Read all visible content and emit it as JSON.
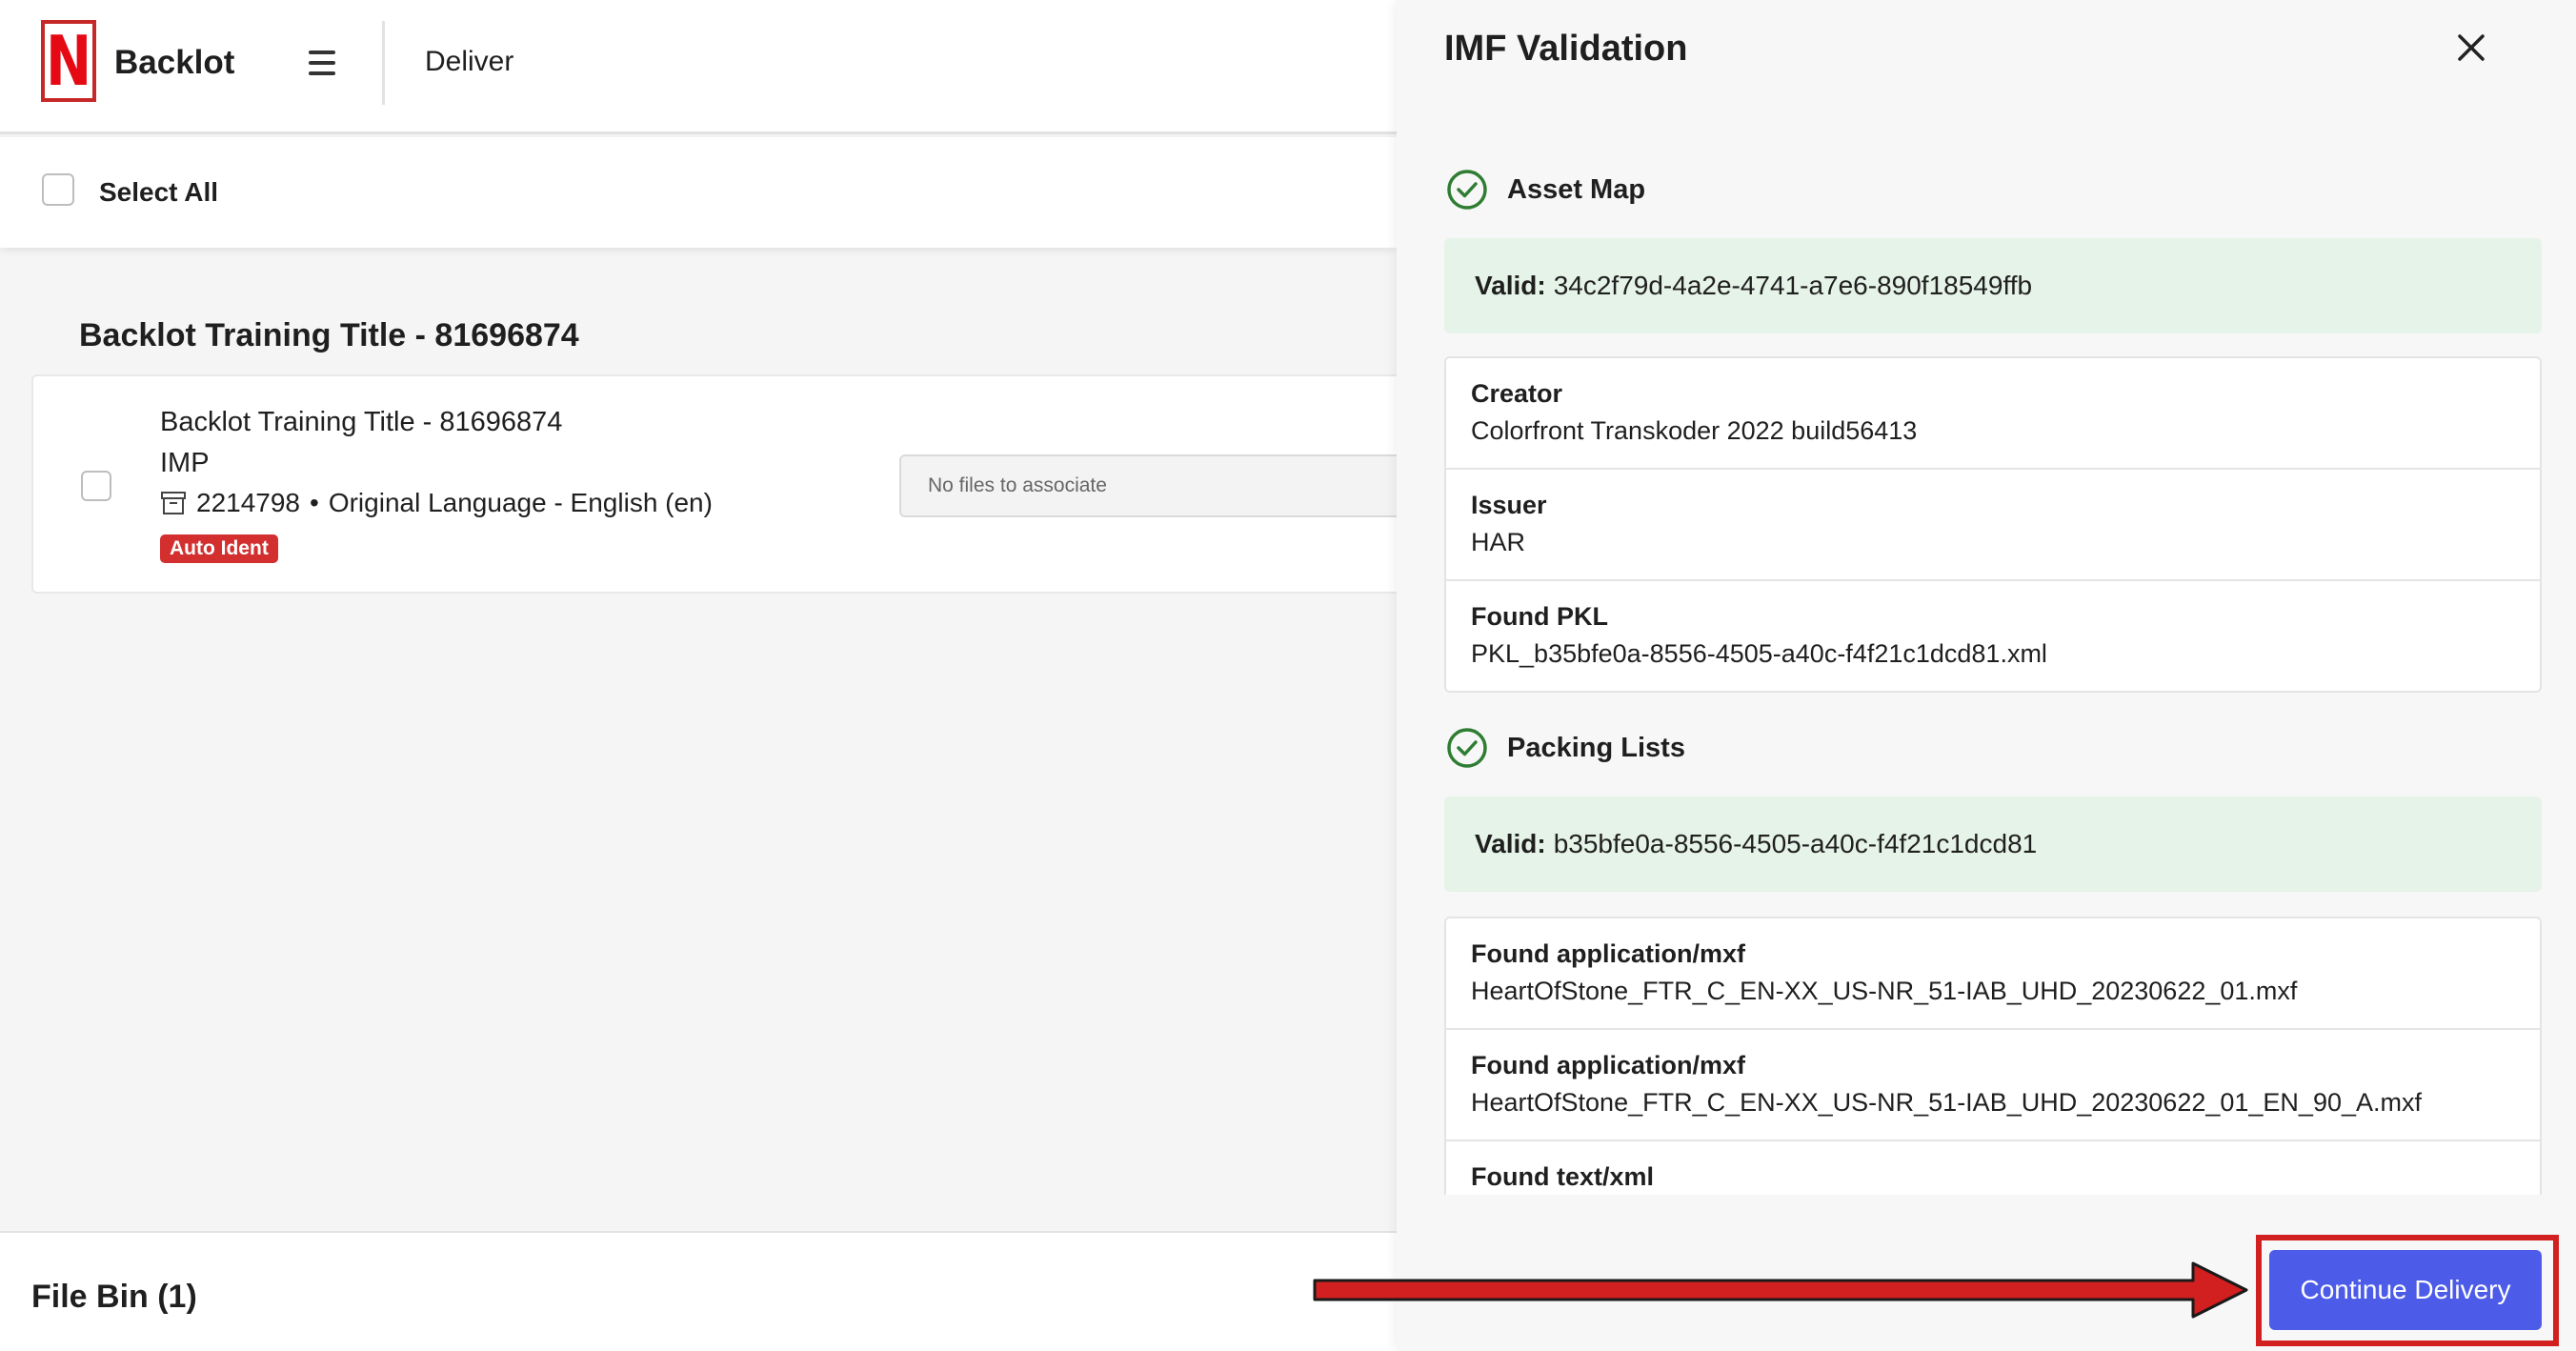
{
  "app": {
    "brand": "Backlot",
    "logo_letter": "N",
    "nav_current": "Deliver",
    "select_all_label": "Select All"
  },
  "group": {
    "title": "Backlot Training Title - 81696874",
    "item": {
      "title": "Backlot Training Title - 81696874",
      "type": "IMP",
      "id": "2214798",
      "separator": "•",
      "language": "Original Language - English (en)",
      "badge": "Auto Ident",
      "association_placeholder": "No files to associate"
    }
  },
  "file_bin": {
    "label": "File Bin (1)"
  },
  "panel": {
    "title": "IMF Validation",
    "asset_map": {
      "label": "Asset Map",
      "valid_label": "Valid:",
      "valid_value": "34c2f79d-4a2e-4741-a7e6-890f18549ffb",
      "rows": [
        {
          "key": "Creator",
          "value": "Colorfront Transkoder 2022 build56413"
        },
        {
          "key": "Issuer",
          "value": "HAR"
        },
        {
          "key": "Found PKL",
          "value": "PKL_b35bfe0a-8556-4505-a40c-f4f21c1dcd81.xml"
        }
      ]
    },
    "packing_lists": {
      "label": "Packing Lists",
      "valid_label": "Valid:",
      "valid_value": "b35bfe0a-8556-4505-a40c-f4f21c1dcd81",
      "rows": [
        {
          "key": "Found application/mxf",
          "value": "HeartOfStone_FTR_C_EN-XX_US-NR_51-IAB_UHD_20230622_01.mxf"
        },
        {
          "key": "Found application/mxf",
          "value": "HeartOfStone_FTR_C_EN-XX_US-NR_51-IAB_UHD_20230622_01_EN_90_A.mxf"
        },
        {
          "key": "Found text/xml",
          "value": ""
        }
      ]
    },
    "continue_label": "Continue Delivery"
  },
  "colors": {
    "accent": "#4c5be8",
    "valid_bg": "#e6f3e8",
    "success": "#2e7d32",
    "badge": "#d32f2f",
    "annotation": "#d21f1f"
  }
}
